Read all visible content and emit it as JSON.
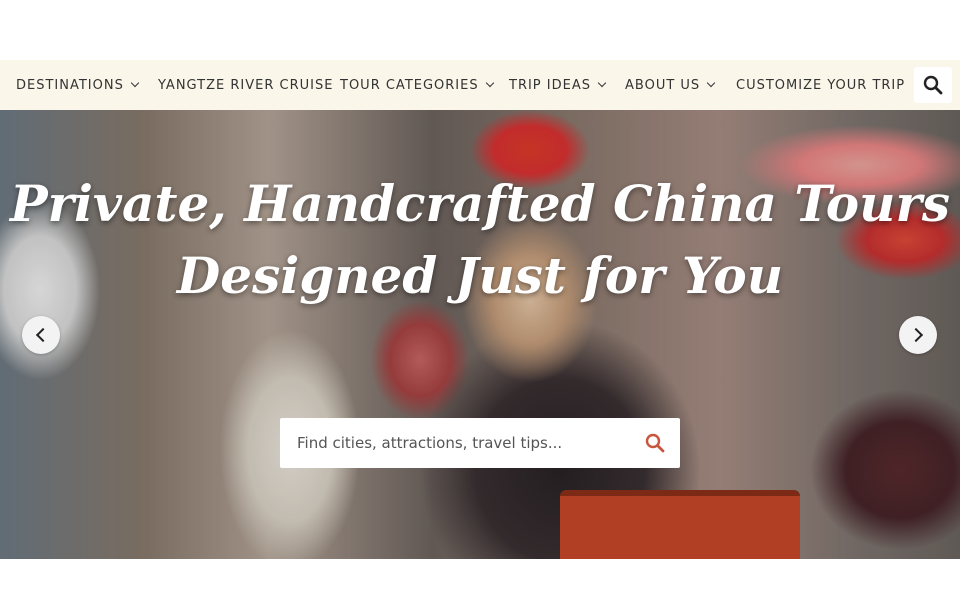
{
  "nav": {
    "items": [
      {
        "label": "DESTINATIONS",
        "has_dropdown": true
      },
      {
        "label": "YANGTZE RIVER CRUISE",
        "has_dropdown": false
      },
      {
        "label": "TOUR CATEGORIES",
        "has_dropdown": true
      },
      {
        "label": "TRIP IDEAS",
        "has_dropdown": true
      },
      {
        "label": "ABOUT US",
        "has_dropdown": true
      },
      {
        "label": "CUSTOMIZE YOUR TRIP",
        "has_dropdown": false
      }
    ],
    "search_icon": "search-icon",
    "background": "#faf6ea"
  },
  "hero": {
    "headline_line1": "Private, Handcrafted China Tours",
    "headline_line2": "Designed Just for You",
    "prev_icon": "chevron-left-icon",
    "next_icon": "chevron-right-icon",
    "search": {
      "placeholder": "Find cities, attractions, travel tips...",
      "icon": "search-icon",
      "icon_color": "#c8553d"
    }
  }
}
